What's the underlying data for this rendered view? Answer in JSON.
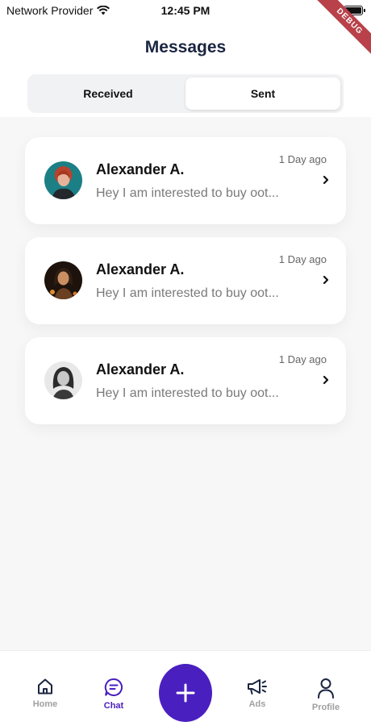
{
  "status_bar": {
    "carrier": "Network Provider",
    "time": "12:45 PM"
  },
  "debug_banner": "DEBUG",
  "header": {
    "title": "Messages"
  },
  "tabs": [
    {
      "label": "Received",
      "active": false
    },
    {
      "label": "Sent",
      "active": true
    }
  ],
  "messages": [
    {
      "name": "Alexander A.",
      "preview": "Hey I am interested to buy oot...",
      "time": "1 Day ago",
      "avatar": "avatar-1"
    },
    {
      "name": "Alexander A.",
      "preview": "Hey I am interested to buy oot...",
      "time": "1 Day ago",
      "avatar": "avatar-2"
    },
    {
      "name": "Alexander A.",
      "preview": "Hey I am interested to buy oot...",
      "time": "1 Day ago",
      "avatar": "avatar-3"
    }
  ],
  "bottom_nav": {
    "items": [
      {
        "label": "Home",
        "icon": "home-icon"
      },
      {
        "label": "Chat",
        "icon": "chat-icon"
      },
      {
        "label": "Ads",
        "icon": "megaphone-icon"
      },
      {
        "label": "Profile",
        "icon": "profile-icon"
      }
    ],
    "active": "Chat",
    "fab_icon": "plus-icon"
  },
  "colors": {
    "accent": "#4a1fbf",
    "title": "#1a2540",
    "background": "#f7f7f8",
    "debug": "#b8414a"
  }
}
